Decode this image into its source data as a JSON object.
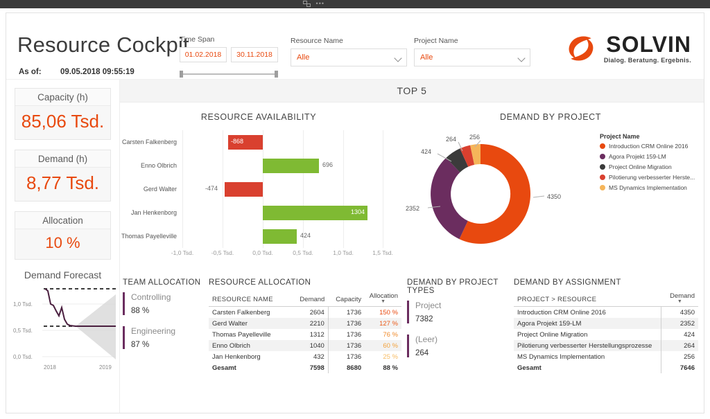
{
  "window": {
    "focus_icon": "focus-mode-icon",
    "more_icon": "more-options-icon"
  },
  "header": {
    "title": "Resource Cockpit",
    "asof_label": "As of:",
    "asof_value": "09.05.2018 09:55:19",
    "timespan": {
      "label": "Time Span",
      "start": "01.02.2018",
      "end": "30.11.2018"
    },
    "resource_filter": {
      "label": "Resource Name",
      "value": "Alle"
    },
    "project_filter": {
      "label": "Project Name",
      "value": "Alle"
    },
    "logo": {
      "word": "SOLVIN",
      "tagline": "Dialog. Beratung. Ergebnis."
    }
  },
  "kpis": [
    {
      "title": "Capacity (h)",
      "value": "85,06 Tsd."
    },
    {
      "title": "Demand (h)",
      "value": "8,77 Tsd."
    },
    {
      "title": "Allocation",
      "value": "10 %"
    }
  ],
  "forecast": {
    "title": "Demand Forecast",
    "y_ticks": [
      "1,0 Tsd.",
      "0,5 Tsd.",
      "0,0 Tsd."
    ],
    "x_ticks": [
      "2018",
      "2019"
    ],
    "chart_data": {
      "type": "line",
      "title": "Demand Forecast",
      "x": [
        "2018-01",
        "2018-02",
        "2018-03",
        "2018-04",
        "2018-05",
        "2018-06",
        "2018-07",
        "2018-08",
        "2018-09",
        "2018-10",
        "2018-11",
        "2018-12",
        "2019-01"
      ],
      "series": [
        {
          "name": "Demand",
          "values": [
            1280,
            1255,
            1010,
            985,
            880,
            800,
            940,
            760,
            700,
            690,
            690,
            690,
            690
          ]
        }
      ],
      "reference_lines": [
        1280,
        690
      ],
      "confidence_band": {
        "upper": [
          690,
          780,
          900,
          1020,
          1140,
          1260
        ],
        "lower": [
          690,
          600,
          480,
          360,
          230,
          110
        ]
      },
      "ylim": [
        0,
        1400
      ],
      "ylabel": "",
      "xlabel": ""
    }
  },
  "top5_banner": "TOP 5",
  "availability": {
    "title": "RESOURCE AVAILABILITY",
    "chart_data": {
      "type": "bar",
      "orientation": "horizontal",
      "title": "RESOURCE AVAILABILITY",
      "categories": [
        "Carsten Falkenberg",
        "Enno Olbrich",
        "Gerd Walter",
        "Jan Henkenborg",
        "Thomas Payelleville"
      ],
      "values": [
        -868,
        696,
        -474,
        1304,
        424
      ],
      "xlim": [
        -1000,
        1500
      ],
      "x_ticks": [
        "-1,0 Tsd.",
        "-0,5 Tsd.",
        "0,0 Tsd.",
        "0,5 Tsd.",
        "1,0 Tsd.",
        "1,5 Tsd."
      ],
      "x_tick_values": [
        -1000,
        -500,
        0,
        500,
        1000,
        1500
      ],
      "colors": {
        "negative": "#d9402f",
        "positive": "#7fba33"
      }
    }
  },
  "demand_by_project": {
    "title": "DEMAND BY PROJECT",
    "legend_title": "Project Name",
    "chart_data": {
      "type": "pie",
      "variant": "donut",
      "title": "DEMAND BY PROJECT",
      "labels": [
        "Introduction CRM Online 2016",
        "Agora Projekt 159-LM",
        "Project Online Migration",
        "Pilotierung verbesserter Herste...",
        "MS Dynamics Implementation"
      ],
      "values": [
        4350,
        2352,
        424,
        264,
        256
      ],
      "colors": [
        "#e8490f",
        "#6b2d5f",
        "#3b3b3b",
        "#d9402f",
        "#f5b55a"
      ],
      "total": 7646
    }
  },
  "team_allocation": {
    "title": "TEAM ALLOCATION",
    "items": [
      {
        "name": "Controlling",
        "value": "88 %"
      },
      {
        "name": "Engineering",
        "value": "87 %"
      }
    ]
  },
  "resource_allocation": {
    "title": "RESOURCE ALLOCATION",
    "columns": [
      "RESOURCE NAME",
      "Demand",
      "Capacity",
      "Allocation"
    ],
    "sorted_by": "Allocation",
    "rows": [
      {
        "name": "Carsten Falkenberg",
        "demand": "2604",
        "capacity": "1736",
        "allocation": "150 %",
        "allocation_color": "#e8490f"
      },
      {
        "name": "Gerd Walter",
        "demand": "2210",
        "capacity": "1736",
        "allocation": "127 %",
        "allocation_color": "#ea5a18"
      },
      {
        "name": "Thomas Payelleville",
        "demand": "1312",
        "capacity": "1736",
        "allocation": "76 %",
        "allocation_color": "#f08a2a"
      },
      {
        "name": "Enno Olbrich",
        "demand": "1040",
        "capacity": "1736",
        "allocation": "60 %",
        "allocation_color": "#f3a23c"
      },
      {
        "name": "Jan Henkenborg",
        "demand": "432",
        "capacity": "1736",
        "allocation": "25 %",
        "allocation_color": "#f7bb62"
      }
    ],
    "total": {
      "name": "Gesamt",
      "demand": "7598",
      "capacity": "8680",
      "allocation": "88 %"
    }
  },
  "demand_by_project_types": {
    "title": "DEMAND BY PROJECT TYPES",
    "items": [
      {
        "name": "Project",
        "value": "7382"
      },
      {
        "name": "(Leer)",
        "value": "264"
      }
    ]
  },
  "demand_by_assignment": {
    "title": "DEMAND BY ASSIGNMENT",
    "columns": [
      "PROJECT > RESOURCE",
      "Demand"
    ],
    "sorted_by": "Demand",
    "rows": [
      {
        "name": "Introduction CRM Online 2016",
        "demand": "4350"
      },
      {
        "name": "Agora Projekt 159-LM",
        "demand": "2352"
      },
      {
        "name": "Project Online Migration",
        "demand": "424"
      },
      {
        "name": "Pilotierung verbesserter Herstellungsprozesse",
        "demand": "264"
      },
      {
        "name": "MS Dynamics Implementation",
        "demand": "256"
      }
    ],
    "total": {
      "name": "Gesamt",
      "demand": "7646"
    }
  },
  "theme": {
    "accent_orange": "#e8490f",
    "green": "#7fba33",
    "red": "#d9402f",
    "purple": "#6b2d5f",
    "dark_gray": "#3b3b3b",
    "light_orange": "#f5b55a"
  }
}
